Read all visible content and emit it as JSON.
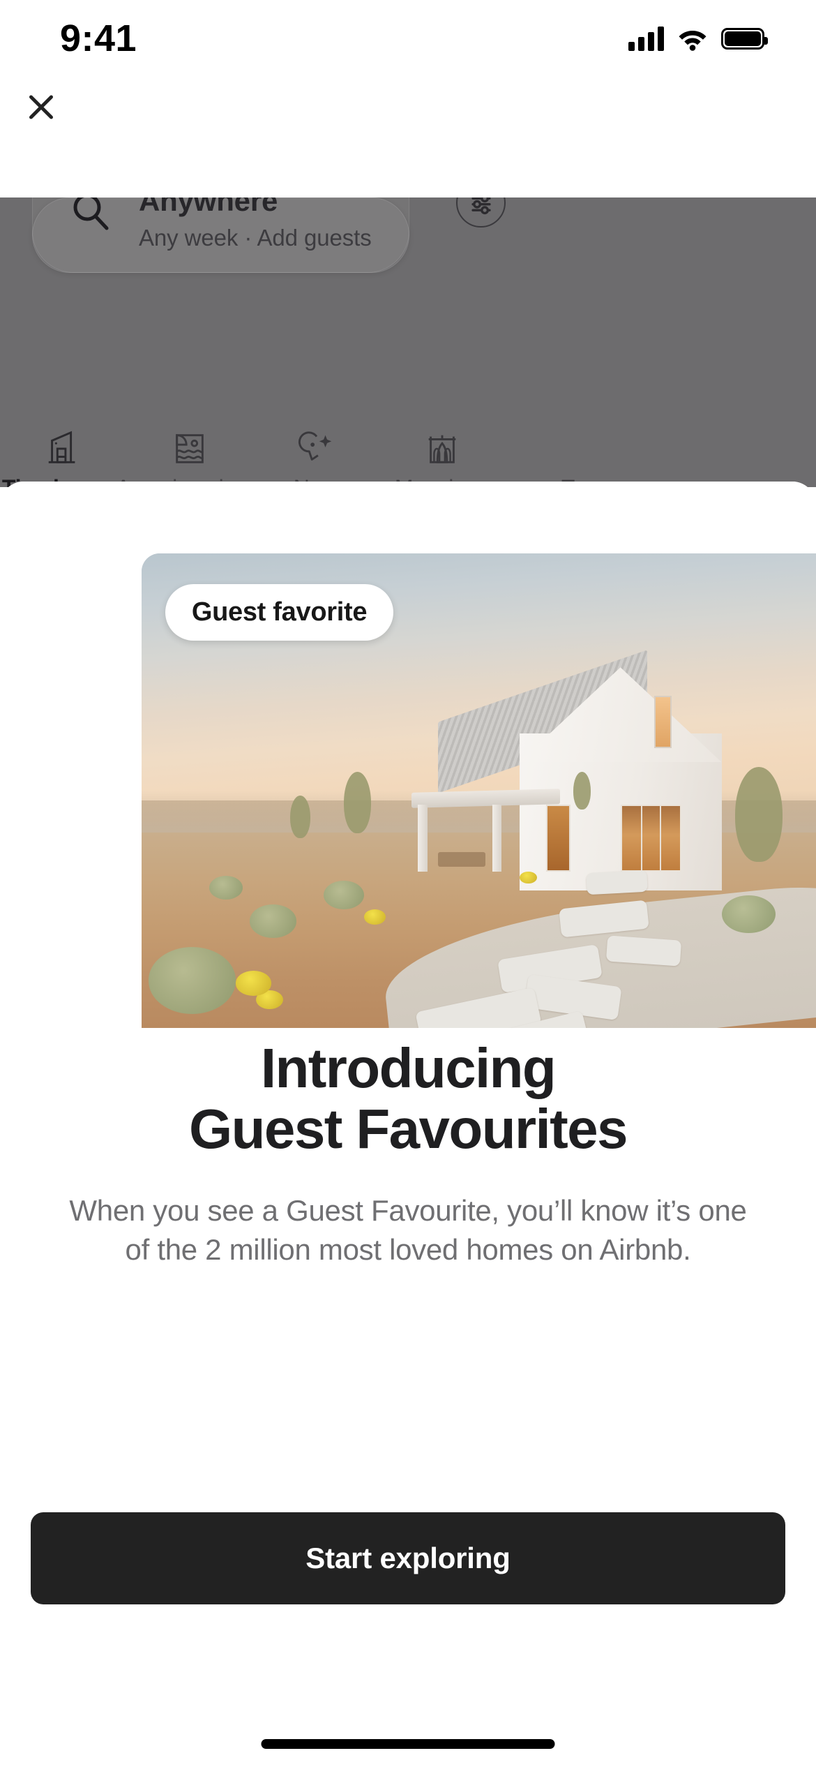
{
  "status_bar": {
    "time": "9:41",
    "signal_icon": "cellular-bars-icon",
    "wifi_icon": "wifi-icon",
    "battery_icon": "battery-full-icon"
  },
  "header": {
    "close_icon": "close-icon"
  },
  "background_app": {
    "search": {
      "icon": "search-icon",
      "title": "Anywhere",
      "subtitle": "Any week  ·  Add guests",
      "filter_icon": "filter-sliders-icon"
    },
    "categories": [
      {
        "label": "Tiny homes",
        "icon": "tiny-home-icon",
        "active": true
      },
      {
        "label": "Amazing views",
        "icon": "amazing-views-icon",
        "active": false
      },
      {
        "label": "New",
        "icon": "new-sparkle-icon",
        "active": false
      },
      {
        "label": "Mansions",
        "icon": "mansion-icon",
        "active": false
      },
      {
        "label": "T",
        "icon": "partial-icon",
        "active": false
      }
    ]
  },
  "phone_mockup": {
    "close_icon": "close-icon",
    "cursor_indicator": "tap-cursor-dot"
  },
  "modal": {
    "photo": {
      "badge_label": "Guest favorite",
      "alt": "Modern white desert house at sunset with stone pathway"
    },
    "headline_line1": "Introducing",
    "headline_line2": "Guest Favourites",
    "body": "When you see a Guest Favourite, you’ll know it’s one of the 2 million most loved homes on Airbnb.",
    "cta_label": "Start exploring"
  },
  "system": {
    "home_indicator": "home-indicator"
  },
  "colors": {
    "cta_background": "#222222",
    "cta_text": "#ffffff",
    "overlay_dim": "#6d6c6e",
    "headline": "#1f1f21",
    "body_text": "#6f6f72",
    "sheet_background": "#ffffff"
  }
}
